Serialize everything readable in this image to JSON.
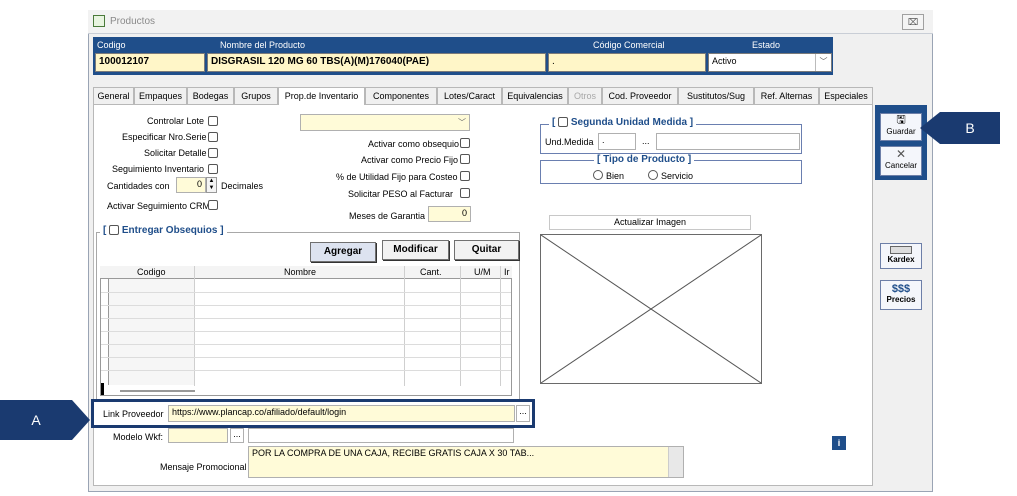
{
  "window": {
    "title": "Productos",
    "close_label": "⌧"
  },
  "header": {
    "codigo_label": "Codigo",
    "nombre_label": "Nombre del Producto",
    "codcom_label": "Código Comercial",
    "estado_label": "Estado",
    "codigo_value": "100012107",
    "nombre_value": "DISGRASIL 120 MG 60 TBS(A)(M)176040(PAE)",
    "codcom_value": ".",
    "estado_value": "Activo"
  },
  "tabs": [
    {
      "label": "General"
    },
    {
      "label": "Empaques"
    },
    {
      "label": "Bodegas"
    },
    {
      "label": "Grupos"
    },
    {
      "label": "Prop.de Inventario"
    },
    {
      "label": "Componentes"
    },
    {
      "label": "Lotes/Caract"
    },
    {
      "label": "Equivalencias"
    },
    {
      "label": "Otros"
    },
    {
      "label": "Cod. Proveedor"
    },
    {
      "label": "Sustitutos/Sug"
    },
    {
      "label": "Ref. Alternas"
    },
    {
      "label": "Especiales"
    }
  ],
  "left_opts": {
    "controlar_lote": "Controlar Lote",
    "especificar_serie": "Especificar Nro.Serie",
    "solicitar_detalle": "Solicitar Detalle",
    "seguimiento_inv": "Seguimiento Inventario",
    "cantidades_con": "Cantidades con",
    "decimales_value": "0",
    "decimales": "Decimales",
    "crm": "Activar Seguimiento CRM"
  },
  "mid_opts": {
    "obsequio": "Activar como obsequio",
    "precio_fijo": "Activar como Precio Fijo",
    "utilidad": "% de Utilidad Fijo para Costeo",
    "peso": "Solicitar  PESO  al  Facturar",
    "garantia": "Meses de Garantia",
    "garantia_value": "0"
  },
  "segunda": {
    "title": "Segunda Unidad Medida",
    "und_label": "Und.Medida",
    "und_value": ".",
    "ellipsis": "..."
  },
  "tipo": {
    "title": "Tipo de Producto",
    "bien": "Bien",
    "servicio": "Servicio"
  },
  "imagen": {
    "update_label": "Actualizar Imagen"
  },
  "obsequios": {
    "title": "Entregar Obsequios",
    "agregar": "Agregar",
    "modificar": "Modificar",
    "quitar": "Quitar",
    "columns": [
      "Codigo",
      "Nombre",
      "Cant.",
      "U/M",
      "Ir"
    ]
  },
  "link": {
    "label": "Link Proveedor",
    "value": "https://www.plancap.co/afiliado/default/login",
    "ellipsis": "..."
  },
  "wkf": {
    "label": "Modelo Wkf:",
    "ellipsis": "..."
  },
  "mensaje": {
    "label": "Mensaje Promocional",
    "value": "POR LA COMPRA DE UNA CAJA, RECIBE GRATIS CAJA X 30 TAB..."
  },
  "sidebar": {
    "guardar": "Guardar",
    "cancelar": "Cancelar",
    "kardex": "Kardex",
    "precios_symbol": "$$$",
    "precios": "Precios"
  },
  "callouts": {
    "a": "A",
    "b": "B"
  },
  "colors": {
    "header_bg": "#1f4e8a",
    "field_yellow": "#fff6c8",
    "callout": "#1a3a70"
  }
}
